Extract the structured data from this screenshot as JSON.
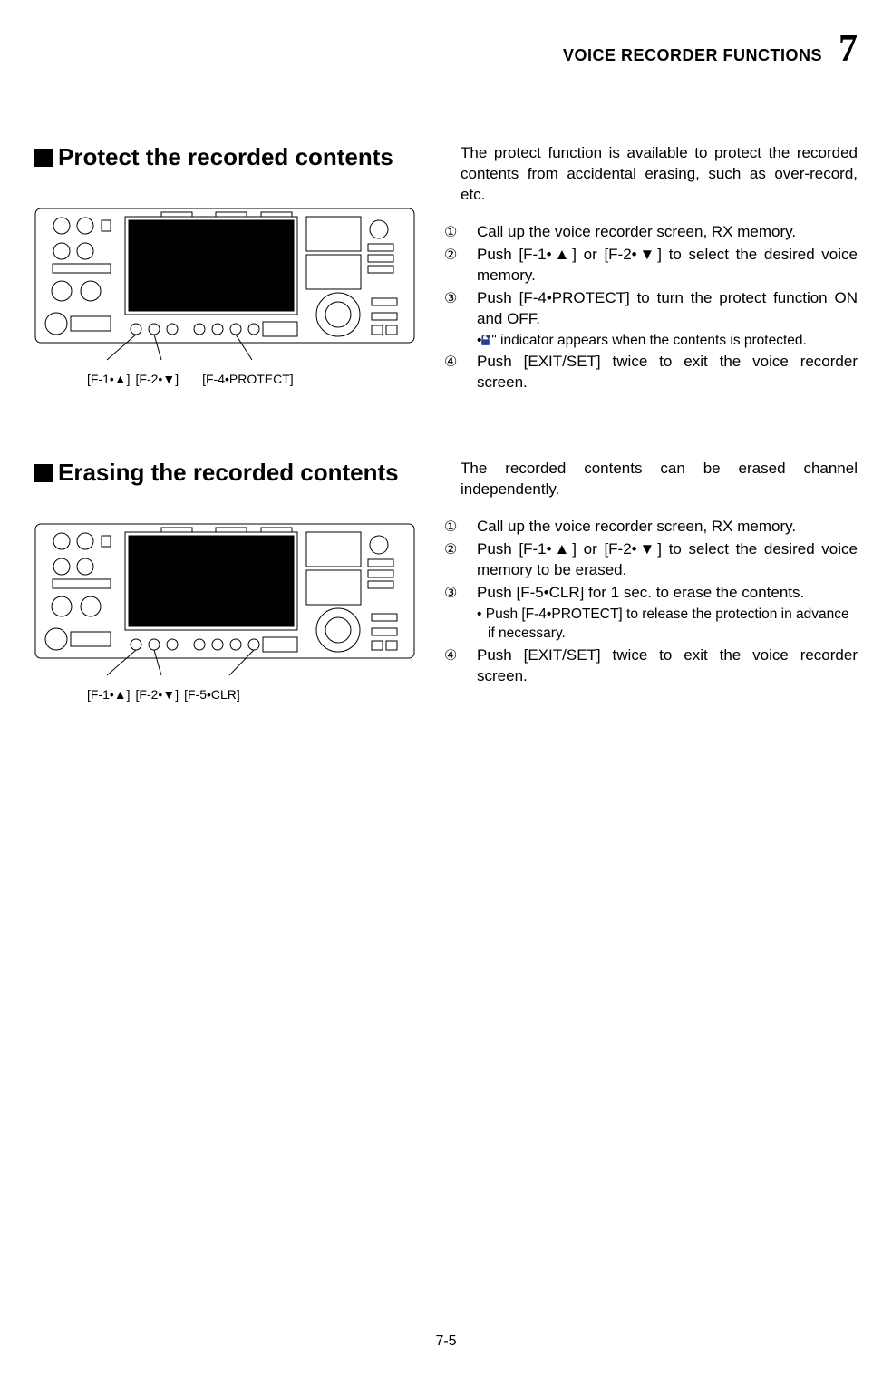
{
  "header": {
    "title": "VOICE RECORDER FUNCTIONS",
    "chapter": "7"
  },
  "section1": {
    "title": "Protect the recorded contents",
    "intro": "The protect function is available to protect the recorded contents from accidental erasing, such as over-record, etc.",
    "step1": "Call up the voice recorder screen, RX memory.",
    "step2": "Push [F-1•▲] or [F-2•▼] to select the desired voice memory.",
    "step3": "Push [F-4•PROTECT] to turn the protect function ON and OFF.",
    "sub3a_pre": "• \"",
    "sub3a_post": "\" indicator appears when the contents is protected.",
    "step4": "Push [EXIT/SET] twice to exit the voice recorder screen.",
    "callout1": "[F-1•▲]",
    "callout2": "[F-2•▼]",
    "callout3": "[F-4•PROTECT]"
  },
  "section2": {
    "title": "Erasing the recorded contents",
    "intro": "The recorded contents can be erased channel independently.",
    "step1": "Call up the voice recorder screen, RX memory.",
    "step2": "Push [F-1•▲] or [F-2•▼] to select the desired voice memory to be erased.",
    "step3": "Push [F-5•CLR] for 1 sec. to erase the contents.",
    "sub3a": "• Push [F-4•PROTECT] to release the protection in advance if necessary.",
    "step4": "Push [EXIT/SET] twice to exit the voice recorder screen.",
    "callout1": "[F-1•▲]",
    "callout2": "[F-2•▼]",
    "callout3": "[F-5•CLR]"
  },
  "glyphs": {
    "c1": "①",
    "c2": "②",
    "c3": "③",
    "c4": "④"
  },
  "page_number": "7-5"
}
